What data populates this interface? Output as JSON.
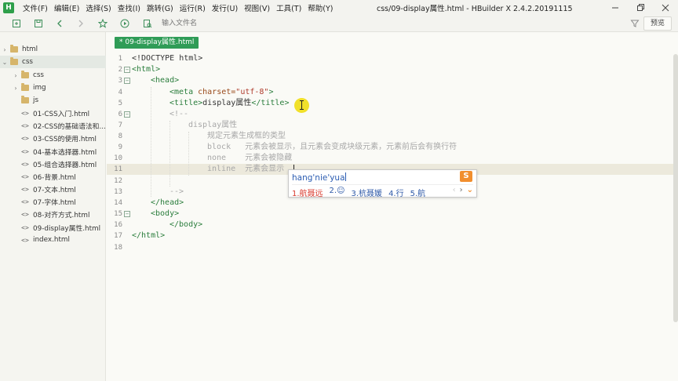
{
  "app": {
    "logo": "H",
    "window_title": "css/09-display属性.html - HBuilder X 2.4.2.20191115",
    "menu": [
      "文件(F)",
      "编辑(E)",
      "选择(S)",
      "查找(I)",
      "跳转(G)",
      "运行(R)",
      "发行(U)",
      "视图(V)",
      "工具(T)",
      "帮助(Y)"
    ]
  },
  "toolbar": {
    "search_placeholder": "输入文件名",
    "preview_label": "预览"
  },
  "sidebar": {
    "items": [
      {
        "label": "html",
        "type": "folder",
        "arrow": "›"
      },
      {
        "label": "css",
        "type": "folder",
        "arrow": "⌄"
      },
      {
        "label": "css",
        "type": "folder",
        "arrow": "›"
      },
      {
        "label": "img",
        "type": "folder",
        "arrow": "›"
      },
      {
        "label": "js",
        "type": "folder",
        "arrow": ""
      },
      {
        "label": "01-CSS入门.html",
        "type": "file",
        "arrow": ""
      },
      {
        "label": "02-CSS的基础语法和...",
        "type": "file",
        "arrow": ""
      },
      {
        "label": "03-CSS的使用.html",
        "type": "file",
        "arrow": ""
      },
      {
        "label": "04-基本选择器.html",
        "type": "file",
        "arrow": ""
      },
      {
        "label": "05-组合选择器.html",
        "type": "file",
        "arrow": ""
      },
      {
        "label": "06-背景.html",
        "type": "file",
        "arrow": ""
      },
      {
        "label": "07-文本.html",
        "type": "file",
        "arrow": ""
      },
      {
        "label": "07-字体.html",
        "type": "file",
        "arrow": ""
      },
      {
        "label": "08-对齐方式.html",
        "type": "file",
        "arrow": ""
      },
      {
        "label": "09-display属性.html",
        "type": "file",
        "arrow": ""
      },
      {
        "label": "index.html",
        "type": "file",
        "arrow": ""
      }
    ]
  },
  "editor": {
    "tab_label": "* 09-display属性.html",
    "line_numbers": [
      "1",
      "2",
      "3",
      "4",
      "5",
      "6",
      "7",
      "8",
      "9",
      "10",
      "11",
      "12",
      "13",
      "14",
      "15",
      "16",
      "17",
      "18"
    ],
    "code": {
      "l1": "<!DOCTYPE html>",
      "l2": "<html>",
      "l3": "<head>",
      "l4_tag_open": "<meta ",
      "l4_attr": "charset=",
      "l4_str": "\"utf-8\"",
      "l4_tag_close": ">",
      "l5_open": "<title>",
      "l5_text": "display属性",
      "l5_close": "</title>",
      "l6": "<!--",
      "l7": "display属性",
      "l8": "规定元素生成框的类型",
      "l9": "block   元素会被显示，且元素会变成块级元素，元素前后会有换行符",
      "l10": "none    元素会被隐藏",
      "l11": "inline  元素会显示",
      "l13": "-->",
      "l14": "</head>",
      "l15": "<body>",
      "l16": "</body>",
      "l17": "</html>"
    }
  },
  "ime": {
    "input": "hang'nie'yua",
    "candidates": [
      "1.航聂远",
      "2.☺",
      "3.杭聂媛",
      "4.行",
      "5.航"
    ],
    "prev": "‹",
    "next": "›",
    "more": "⌄",
    "logo": "S"
  }
}
